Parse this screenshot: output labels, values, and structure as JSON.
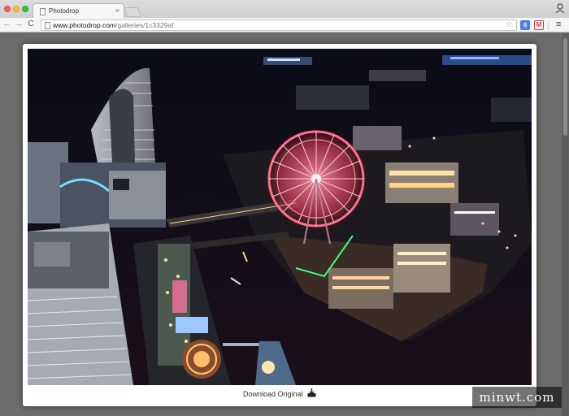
{
  "browser": {
    "tab": {
      "title": "Photodrop",
      "close_glyph": "×"
    },
    "toolbar": {
      "back_glyph": "←",
      "forward_glyph": "→",
      "reload_glyph": "C",
      "url_host": "www.photodrop.com",
      "url_path": "/galleries/1c3329af",
      "bookmark_glyph": "☆",
      "menu_glyph": "≡"
    },
    "extensions": [
      {
        "name": "translate-icon",
        "glyph": "g"
      },
      {
        "name": "gmail-icon",
        "glyph": "M"
      }
    ]
  },
  "lightbox": {
    "photo_subject": "night aerial cityscape with ferris wheel",
    "download_label": "Download Original",
    "download_icon": "download-icon"
  },
  "watermark": {
    "text": "minwt.com"
  },
  "colors": {
    "overlay": "#6b6b6b",
    "ferris_wheel": "#ff5a78",
    "harbor_water": "#0d0f1a"
  }
}
